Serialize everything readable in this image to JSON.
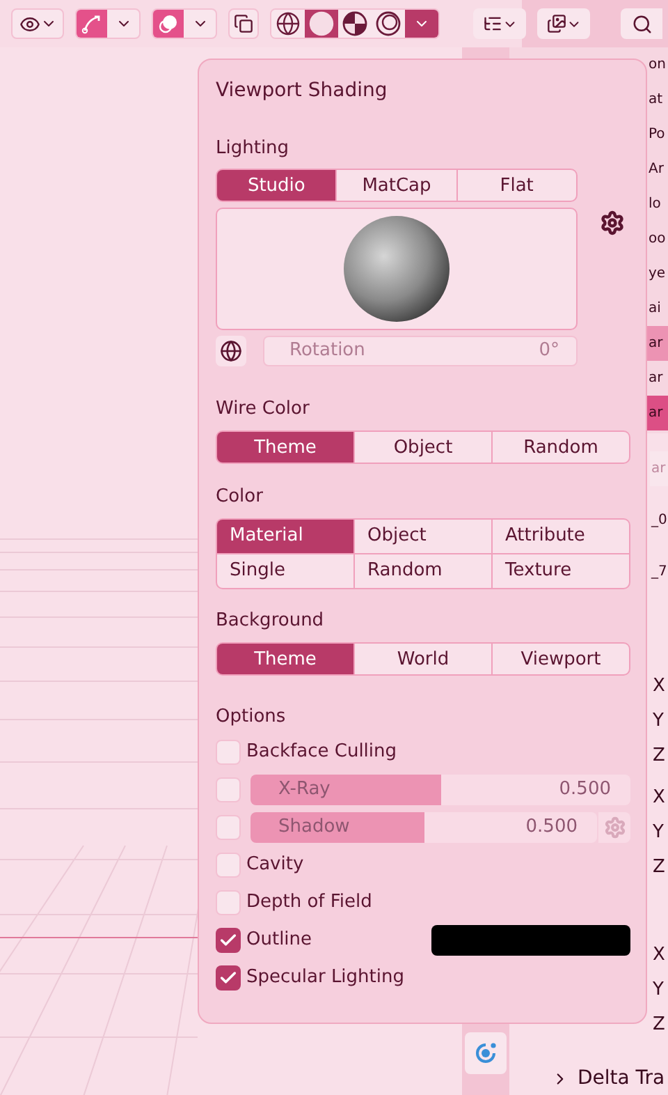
{
  "toolbar": {
    "shading_modes": [
      {
        "kind": "wireframe",
        "selected": false
      },
      {
        "kind": "solid",
        "selected": true
      },
      {
        "kind": "material",
        "selected": false
      },
      {
        "kind": "rendered",
        "selected": false
      }
    ]
  },
  "outliner": {
    "rows": [
      {
        "text": "on",
        "active": false,
        "selected": false
      },
      {
        "text": "at",
        "active": false,
        "selected": false
      },
      {
        "text": "Po",
        "active": false,
        "selected": false
      },
      {
        "text": "Ar",
        "active": false,
        "selected": false
      },
      {
        "text": "lo",
        "active": false,
        "selected": false
      },
      {
        "text": "oo",
        "active": false,
        "selected": false
      },
      {
        "text": "ye",
        "active": false,
        "selected": false
      },
      {
        "text": "ai",
        "active": false,
        "selected": false
      },
      {
        "text": "ar",
        "active": true,
        "selected": false
      },
      {
        "text": "ar",
        "active": false,
        "selected": false
      },
      {
        "text": "ar",
        "active": false,
        "selected": true
      }
    ]
  },
  "properties": {
    "search": "ar",
    "rows": [
      "_0",
      "_7"
    ],
    "axis_groups": [
      [
        "X",
        "Y",
        "Z"
      ],
      [
        "X",
        "Y",
        "Z"
      ],
      [
        "X",
        "Y",
        "Z"
      ]
    ],
    "section": "Delta Tra"
  },
  "popup": {
    "title": "Viewport Shading",
    "lighting": {
      "label": "Lighting",
      "options": [
        {
          "label": "Studio",
          "selected": true
        },
        {
          "label": "MatCap",
          "selected": false
        },
        {
          "label": "Flat",
          "selected": false
        }
      ],
      "rotation": {
        "label": "Rotation",
        "value": "0°"
      }
    },
    "wire_color": {
      "label": "Wire Color",
      "options": [
        {
          "label": "Theme",
          "selected": true
        },
        {
          "label": "Object",
          "selected": false
        },
        {
          "label": "Random",
          "selected": false
        }
      ]
    },
    "color": {
      "label": "Color",
      "options": [
        {
          "label": "Material",
          "selected": true
        },
        {
          "label": "Object",
          "selected": false
        },
        {
          "label": "Attribute",
          "selected": false
        },
        {
          "label": "Single",
          "selected": false
        },
        {
          "label": "Random",
          "selected": false
        },
        {
          "label": "Texture",
          "selected": false
        }
      ]
    },
    "background": {
      "label": "Background",
      "options": [
        {
          "label": "Theme",
          "selected": true
        },
        {
          "label": "World",
          "selected": false
        },
        {
          "label": "Viewport",
          "selected": false
        }
      ]
    },
    "options": {
      "label": "Options",
      "items": [
        {
          "kind": "checkbox",
          "label": "Backface Culling",
          "checked": false
        },
        {
          "kind": "slider",
          "label": "X-Ray",
          "value": "0.500",
          "level": 0.5,
          "checked": false,
          "settings": false
        },
        {
          "kind": "slider",
          "label": "Shadow",
          "value": "0.500",
          "level": 0.5,
          "checked": false,
          "settings": true
        },
        {
          "kind": "checkbox",
          "label": "Cavity",
          "checked": false
        },
        {
          "kind": "checkbox",
          "label": "Depth of Field",
          "checked": false
        },
        {
          "kind": "color",
          "label": "Outline",
          "checked": true,
          "color": "#000000"
        },
        {
          "kind": "checkbox",
          "label": "Specular Lighting",
          "checked": true
        }
      ]
    }
  }
}
